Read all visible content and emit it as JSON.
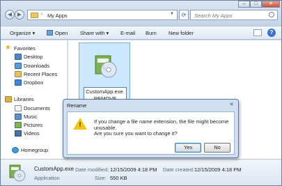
{
  "address": {
    "path": "My Apps",
    "separator": "›"
  },
  "search": {
    "placeholder": "Search My Apps"
  },
  "window_controls": {
    "minimize": "–",
    "maximize": "□",
    "close": "✕"
  },
  "toolbar": {
    "organize": "Organize ▾",
    "open": "Open",
    "share_with": "Share with ▾",
    "email": "E-mail",
    "burn": "Burn",
    "new_folder": "New folder"
  },
  "nav": {
    "favorites": "Favorites",
    "desktop": "Desktop",
    "downloads": "Downloads",
    "recent_places": "Recent Places",
    "dropbox": "Dropbox",
    "libraries": "Libraries",
    "documents": "Documents",
    "music": "Music",
    "pictures": "Pictures",
    "videos": "Videos",
    "homegroup": "Homegroup"
  },
  "file": {
    "rename_text": "CustomApp.exe.REMOVE"
  },
  "details": {
    "name": "CustomApp.exe",
    "type": "Application",
    "date_modified_label": "Date modified:",
    "date_modified": "12/15/2009 4:18 PM",
    "date_created_label": "Date created:",
    "date_created": "12/15/2009 4:18 PM",
    "size_label": "Size:",
    "size": "550 KB"
  },
  "dialog": {
    "title": "Rename",
    "message": "If you change a file name extension, the file might become unusable.",
    "question": "Are you sure you want to change it?",
    "yes": "Yes",
    "no": "No"
  }
}
